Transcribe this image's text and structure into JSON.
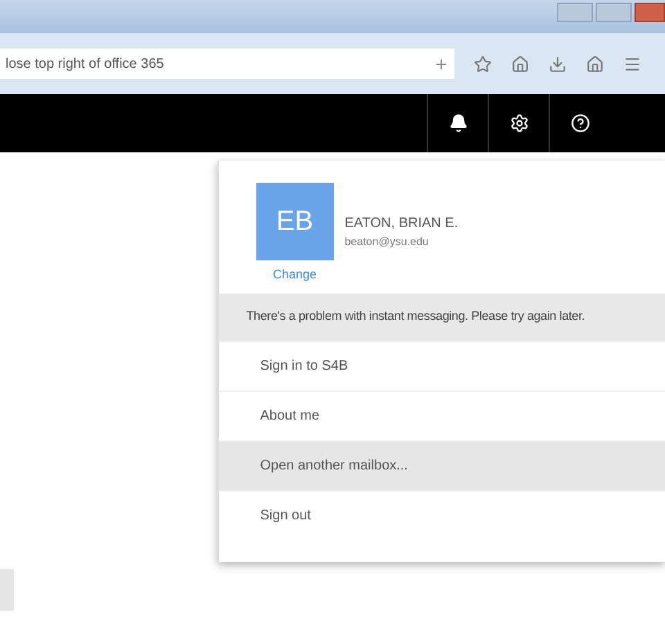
{
  "browser": {
    "address": "lose top right of office 365"
  },
  "account": {
    "initials": "EB",
    "name": "EATON, BRIAN E.",
    "email": "beaton@ysu.edu",
    "change_link": "Change"
  },
  "notice": "There's a problem with instant messaging. Please try again later.",
  "menu": [
    {
      "label": "Sign in to S4B",
      "selected": false
    },
    {
      "label": "About me",
      "selected": false
    },
    {
      "label": "Open another mailbox...",
      "selected": true
    },
    {
      "label": "Sign out",
      "selected": false
    }
  ]
}
